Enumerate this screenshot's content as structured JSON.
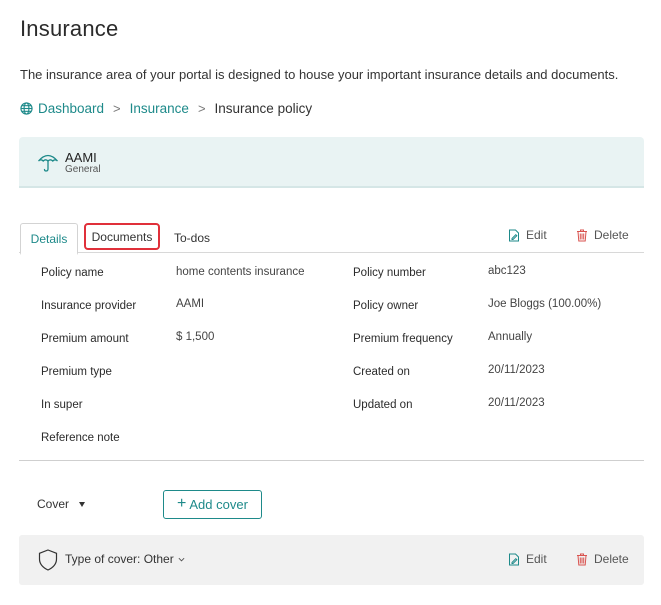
{
  "page": {
    "title": "Insurance",
    "intro": "The insurance area of your portal is designed to house your important insurance details and documents."
  },
  "breadcrumb": {
    "items": [
      "Dashboard",
      "Insurance",
      "Insurance policy"
    ],
    "separator": ">"
  },
  "policy": {
    "insurer": "AAMI",
    "type": "General"
  },
  "tabs": {
    "items": [
      "Details",
      "Documents",
      "To-dos"
    ],
    "active": "Details"
  },
  "actions": {
    "edit": "Edit",
    "delete": "Delete"
  },
  "details": {
    "left": [
      {
        "label": "Policy name",
        "value": "home contents insurance"
      },
      {
        "label": "Insurance provider",
        "value": "AAMI"
      },
      {
        "label": "Premium amount",
        "value": "$ 1,500"
      },
      {
        "label": "Premium type",
        "value": ""
      },
      {
        "label": "In super",
        "value": ""
      },
      {
        "label": "Reference note",
        "value": ""
      }
    ],
    "right": [
      {
        "label": "Policy number",
        "value": "abc123"
      },
      {
        "label": "Policy owner",
        "value": "Joe Bloggs (100.00%)"
      },
      {
        "label": "Premium frequency",
        "value": "Annually"
      },
      {
        "label": "Created on",
        "value": "20/11/2023"
      },
      {
        "label": "Updated on",
        "value": "20/11/2023"
      }
    ]
  },
  "cover": {
    "select_label": "Cover",
    "add_button": "Add cover",
    "add_button_icon": "+",
    "row_label": "Type of cover: Other"
  },
  "colors": {
    "accent": "#1e8a8a",
    "card_bg": "#e9f3f3",
    "highlight": "#e0303a",
    "delete": "#d9534f"
  }
}
